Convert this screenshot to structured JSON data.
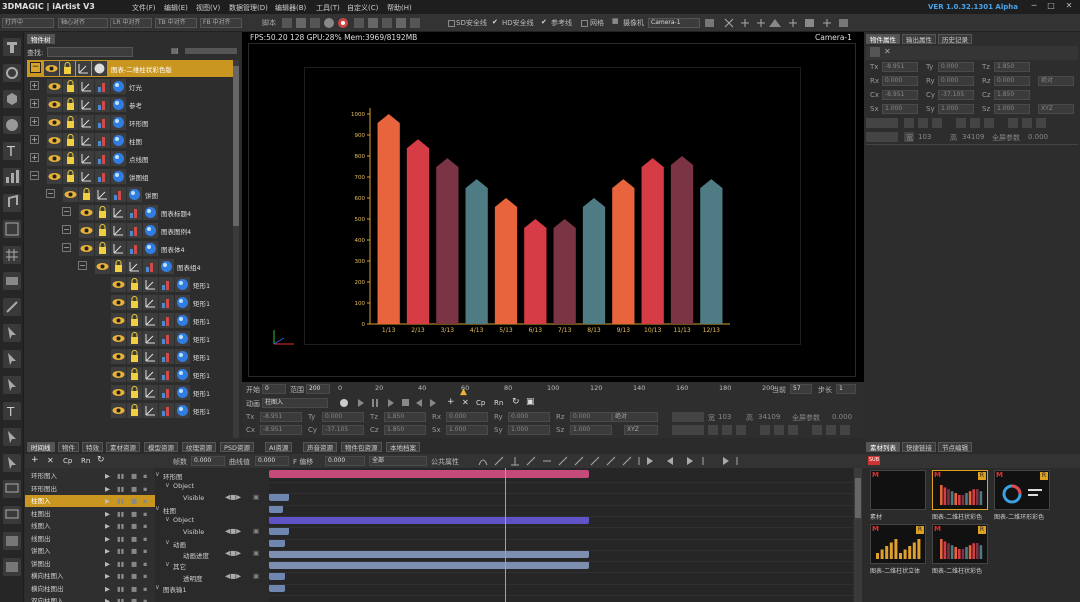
{
  "menubar": {
    "brand": "3DMAGIC | iArtist V3",
    "items": [
      "文件(F)",
      "编辑(E)",
      "视图(V)",
      "数据管理(D)",
      "编辑器(B)",
      "工具(T)",
      "自定义(C)",
      "帮助(H)"
    ],
    "version": "VER 1.0.32.1301 Alpha",
    "window_buttons": [
      "─",
      "□",
      "✕"
    ]
  },
  "toolbar": {
    "drops": [
      "打开中",
      "轴心对齐",
      "LR 中对齐",
      "TB 中对齐",
      "FB 中对齐"
    ],
    "script_label": "脚本",
    "toggles": [
      "SD安全线",
      "HD安全线",
      "参考线",
      "网格"
    ],
    "camera_label": "摄像机",
    "camera_value": "Camera-1"
  },
  "tree": {
    "tab_label": "物件树",
    "search_label": "查找:",
    "root_label": "图表-二维柱状彩色版",
    "rows": [
      {
        "label": "灯光",
        "indent": 0
      },
      {
        "label": "参考",
        "indent": 0
      },
      {
        "label": "环形图",
        "indent": 0
      },
      {
        "label": "柱图",
        "indent": 0
      },
      {
        "label": "点线图",
        "indent": 0
      },
      {
        "label": "饼图组",
        "indent": 0
      },
      {
        "label": "饼图",
        "indent": 1
      },
      {
        "label": "图表标题4",
        "indent": 2
      },
      {
        "label": "图表图例4",
        "indent": 2
      },
      {
        "label": "图表体4",
        "indent": 2
      },
      {
        "label": "图表组4",
        "indent": 3
      },
      {
        "label": "矩形1",
        "indent": 4
      },
      {
        "label": "矩形1",
        "indent": 4
      },
      {
        "label": "矩形1",
        "indent": 4
      },
      {
        "label": "矩形1",
        "indent": 4
      },
      {
        "label": "矩形1",
        "indent": 4
      },
      {
        "label": "矩形1",
        "indent": 4
      },
      {
        "label": "矩形1",
        "indent": 4
      },
      {
        "label": "矩形1",
        "indent": 4
      }
    ]
  },
  "viewport": {
    "stats": "FPS:50.20  128   GPU:28% Mem:3969/8192MB",
    "camera": "Camera-1"
  },
  "chart_data": {
    "type": "bar",
    "categories": [
      "1/13",
      "2/13",
      "3/13",
      "4/13",
      "5/13",
      "6/13",
      "7/13",
      "8/13",
      "9/13",
      "10/13",
      "11/13",
      "12/13"
    ],
    "values": [
      1000,
      880,
      790,
      690,
      600,
      500,
      500,
      600,
      690,
      790,
      800,
      690
    ],
    "bar_colors": [
      "#e8643c",
      "#d63c46",
      "#7a3444",
      "#4f7c84",
      "#e8643c",
      "#d63c46",
      "#7a3444",
      "#4f7c84",
      "#e8643c",
      "#d63c46",
      "#7a3444",
      "#4f7c84"
    ],
    "yticks": [
      0,
      100,
      200,
      300,
      400,
      500,
      600,
      700,
      800,
      900,
      1000
    ],
    "ylim": [
      0,
      1000
    ]
  },
  "timeline_ruler": {
    "start_label": "开始",
    "start_value": "0",
    "range_label": "范围",
    "range_value": "200",
    "ticks": [
      "0",
      "20",
      "40",
      "60",
      "80",
      "100",
      "120",
      "140",
      "160",
      "180",
      "200"
    ],
    "current_label": "当前",
    "current_value": "57",
    "step_label": "步长",
    "step_value": "1"
  },
  "anim_bar": {
    "label": "动画",
    "value": "柱图入",
    "buttons": [
      "Cp",
      "Rn"
    ]
  },
  "transform": {
    "row1": [
      {
        "label": "Tx",
        "value": "-8.951"
      },
      {
        "label": "Ty",
        "value": "0.000"
      },
      {
        "label": "Tz",
        "value": "1.850"
      },
      {
        "label": "Rx",
        "value": "0.000"
      },
      {
        "label": "Ry",
        "value": "0.000"
      },
      {
        "label": "Rz",
        "value": "0.000"
      }
    ],
    "row2": [
      {
        "label": "Cx",
        "value": "-8.951"
      },
      {
        "label": "Cy",
        "value": "-37.105"
      },
      {
        "label": "Cz",
        "value": "1.850"
      },
      {
        "label": "Sx",
        "value": "1.000"
      },
      {
        "label": "Sy",
        "value": "1.000"
      },
      {
        "label": "Sz",
        "value": "1.000"
      }
    ],
    "mode1": "绝对",
    "mode2": "XYZ",
    "wide_label": "宽",
    "wide_value": "103",
    "high_label": "高",
    "high_value": "34109",
    "fullscreen_label": "全屏参数",
    "fullscreen_value": "0.000"
  },
  "props": {
    "tabs": [
      "物件属性",
      "输出属性",
      "历史记录"
    ],
    "rows": [
      [
        {
          "label": "Tx",
          "value": "-8.951"
        },
        {
          "label": "Ty",
          "value": "0.000"
        },
        {
          "label": "Tz",
          "value": "1.850"
        }
      ],
      [
        {
          "label": "Rx",
          "value": "0.000"
        },
        {
          "label": "Ry",
          "value": "0.000"
        },
        {
          "label": "Rz",
          "value": "0.000"
        }
      ],
      [
        {
          "label": "Cx",
          "value": "-8.951"
        },
        {
          "label": "Cy",
          "value": "-37.105"
        },
        {
          "label": "Cz",
          "value": "1.850"
        }
      ],
      [
        {
          "label": "Sx",
          "value": "1.000"
        },
        {
          "label": "Sy",
          "value": "1.000"
        },
        {
          "label": "Sz",
          "value": "1.000"
        }
      ]
    ],
    "mode1": "绝对",
    "mode2": "XYZ",
    "wide_label": "宽",
    "wide_value": "103",
    "high_label": "高",
    "high_value": "34109",
    "fullscreen_label": "全屏参数",
    "fullscreen_value": "0.000"
  },
  "bottom": {
    "tabs": [
      "时间线",
      "物件",
      "特效",
      "素材资源",
      "模型资源",
      "纹理资源",
      "PSD资源",
      "AI资源",
      "声音资源",
      "物件包资源",
      "本地档案"
    ],
    "frame_label": "帧数",
    "frame_value": "0.000",
    "curve_label": "曲线值",
    "curve_value": "0.000",
    "filter_label": "F 偏移",
    "filter_value": "0.000",
    "all_value": "全部",
    "attr_label": "公共属性",
    "anim_list": [
      "环形图入",
      "环形图出",
      "柱图入",
      "柱图出",
      "线图入",
      "线图出",
      "饼图入",
      "饼图出",
      "横向柱图入",
      "横向柱图出",
      "双向柱图入"
    ],
    "anim_selected": 2,
    "tracks": [
      "环形图",
      "Object",
      "Visible",
      "柱图",
      "Object",
      "Visible",
      "动画",
      "动画进度",
      "其它",
      "透明度",
      "图表输1"
    ]
  },
  "assets": {
    "tabs": [
      "素材列表",
      "快捷链接",
      "节点编辑"
    ],
    "items": [
      {
        "label": "素材",
        "selected": false
      },
      {
        "label": "图表-二维柱状彩色",
        "selected": true
      },
      {
        "label": "图表-二维环形彩色",
        "selected": false
      },
      {
        "label": "图表-二维柱状立体",
        "selected": false
      },
      {
        "label": "图表-二维柱状彩色",
        "selected": false
      }
    ]
  }
}
